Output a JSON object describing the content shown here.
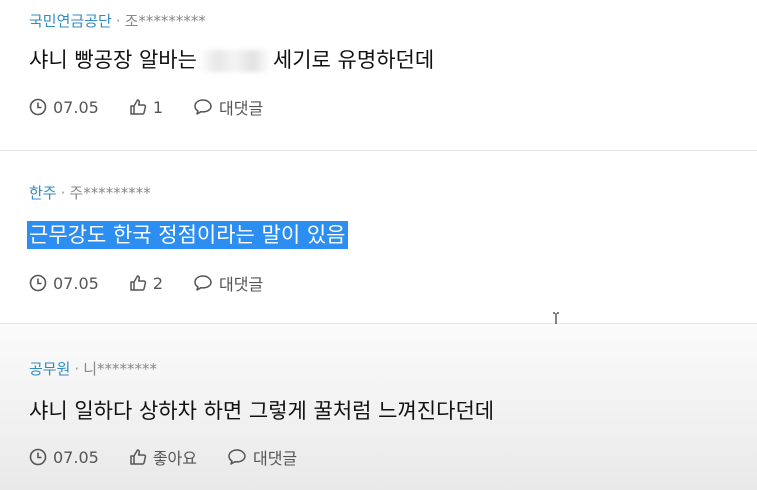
{
  "comments": [
    {
      "author": "국민연금공단",
      "username": "조*********",
      "text_before": "샤니 빵공장 알바는",
      "text_after": "세기로 유명하던데",
      "date": "07.05",
      "likes": "1",
      "reply_label": "대댓글"
    },
    {
      "author": "한주",
      "username": "주*********",
      "text": "근무강도 한국 정점이라는 말이 있음",
      "date": "07.05",
      "likes": "2",
      "reply_label": "대댓글"
    },
    {
      "author": "공무원",
      "username": "니********",
      "text": "샤니 일하다 상하차 하면 그렇게 꿀처럼 느껴진다던데",
      "date": "07.05",
      "likes": "좋아요",
      "reply_label": "대댓글"
    }
  ],
  "meta_separator": "·"
}
